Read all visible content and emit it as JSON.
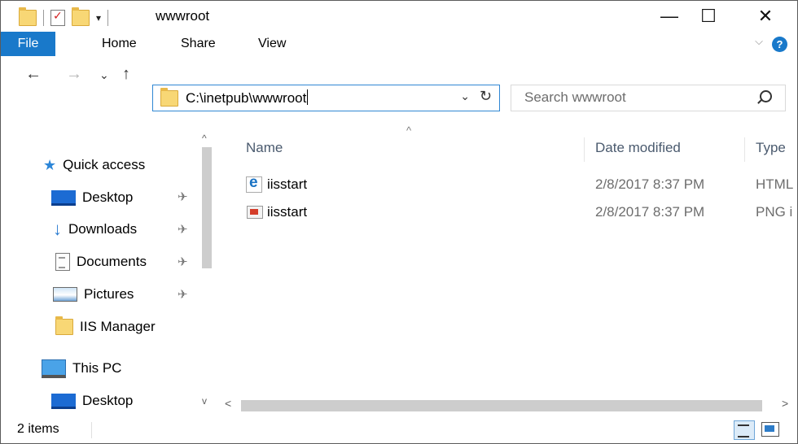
{
  "window": {
    "title": "wwwroot",
    "controls": {
      "minimize": "—",
      "maximize": "☐",
      "close": "✕"
    }
  },
  "quick_access_toolbar": {
    "dropdown_glyph": "▾"
  },
  "ribbon": {
    "tabs": [
      "File",
      "Home",
      "Share",
      "View"
    ],
    "expand_glyph": "⌵",
    "help_glyph": "?"
  },
  "navigation": {
    "back_glyph": "←",
    "forward_glyph": "→",
    "recent_glyph": "⌄",
    "up_glyph": "↑"
  },
  "address_bar": {
    "path": "C:\\inetpub\\wwwroot",
    "dropdown_glyph": "⌄",
    "refresh_glyph": "↻"
  },
  "search": {
    "placeholder": "Search wwwroot"
  },
  "nav_pane": {
    "items": [
      {
        "label": "Quick access",
        "icon": "star-icon"
      },
      {
        "label": "Desktop",
        "icon": "desktop-icon",
        "pinned": true
      },
      {
        "label": "Downloads",
        "icon": "downloads-icon",
        "pinned": true
      },
      {
        "label": "Documents",
        "icon": "documents-icon",
        "pinned": true
      },
      {
        "label": "Pictures",
        "icon": "pictures-icon",
        "pinned": true
      },
      {
        "label": "IIS Manager",
        "icon": "folder-icon"
      },
      {
        "label": "This PC",
        "icon": "computer-icon"
      },
      {
        "label": "Desktop",
        "icon": "desktop-icon"
      }
    ],
    "pin_glyph": "✈"
  },
  "file_list": {
    "columns": [
      "Name",
      "Date modified",
      "Type"
    ],
    "sort_glyph": "^",
    "rows": [
      {
        "name": "iisstart",
        "date": "2/8/2017 8:37 PM",
        "type": "HTML",
        "icon": "html-file-icon"
      },
      {
        "name": "iisstart",
        "date": "2/8/2017 8:37 PM",
        "type": "PNG i",
        "icon": "png-file-icon"
      }
    ]
  },
  "scrollbars": {
    "up_glyph": "^",
    "down_glyph": "v",
    "left_glyph": "<",
    "right_glyph": ">"
  },
  "status_bar": {
    "item_count": "2 items"
  },
  "colors": {
    "accent": "#1979ca",
    "address_border": "#2f87d4",
    "folder": "#f8d775"
  }
}
